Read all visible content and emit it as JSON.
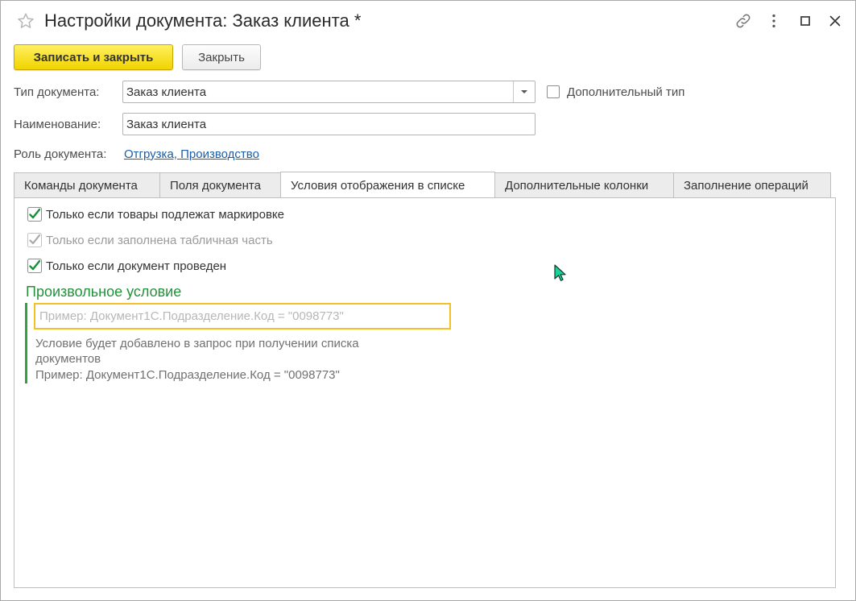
{
  "window": {
    "title": "Настройки документа: Заказ клиента *"
  },
  "toolbar": {
    "save_close_label": "Записать и закрыть",
    "close_label": "Закрыть"
  },
  "form": {
    "doc_type_label": "Тип документа:",
    "doc_type_value": "Заказ клиента",
    "additional_type_label": "Дополнительный тип",
    "additional_type_checked": false,
    "name_label": "Наименование:",
    "name_value": "Заказ клиента",
    "role_label": "Роль документа:",
    "role_link": "Отгрузка, Производство"
  },
  "tabs": [
    {
      "label": "Команды документа",
      "active": false
    },
    {
      "label": "Поля документа",
      "active": false
    },
    {
      "label": "Условия отображения в списке",
      "active": true
    },
    {
      "label": "Дополнительные колонки",
      "active": false
    },
    {
      "label": "Заполнение операций",
      "active": false
    }
  ],
  "conditions": {
    "marking_label": "Только если товары подлежат маркировке",
    "marking_checked": true,
    "table_part_label": "Только если заполнена табличная часть",
    "table_part_checked": true,
    "table_part_disabled": true,
    "posted_label": "Только если документ проведен",
    "posted_checked": true,
    "custom_title": "Произвольное условие",
    "custom_placeholder": "Пример: Документ1С.Подразделение.Код = \"0098773\"",
    "custom_value": "",
    "hint_line1": "Условие будет добавлено в запрос при получении списка",
    "hint_line2": "документов",
    "hint_line3": "Пример: Документ1С.Подразделение.Код = \"0098773\""
  },
  "colors": {
    "accent_green": "#23913a",
    "primary_button": "#f1d400",
    "focus_border": "#f3c126",
    "link": "#1c5ea8"
  }
}
